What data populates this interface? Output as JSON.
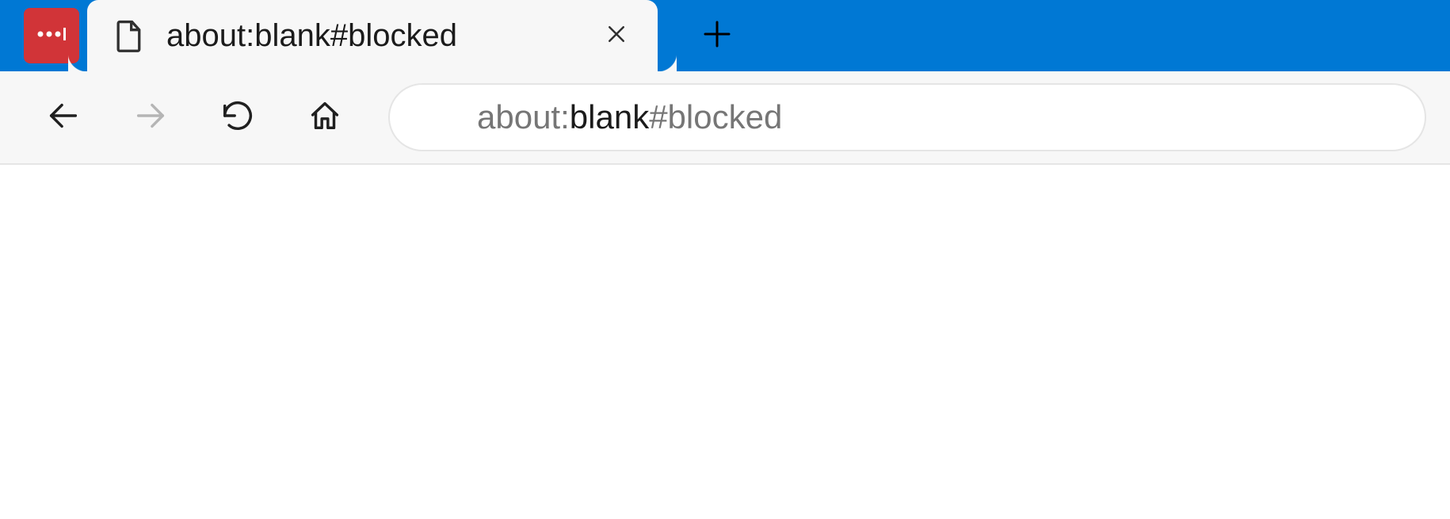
{
  "colors": {
    "tabstrip_bg": "#0078D4",
    "extension_bg": "#D13438",
    "toolbar_bg": "#f7f7f7"
  },
  "extension": {
    "name": "lastpass-icon"
  },
  "tab": {
    "title": "about:blank#blocked"
  },
  "address": {
    "scheme": "about:",
    "host": "blank",
    "rest": "#blocked",
    "full": "about:blank#blocked"
  }
}
